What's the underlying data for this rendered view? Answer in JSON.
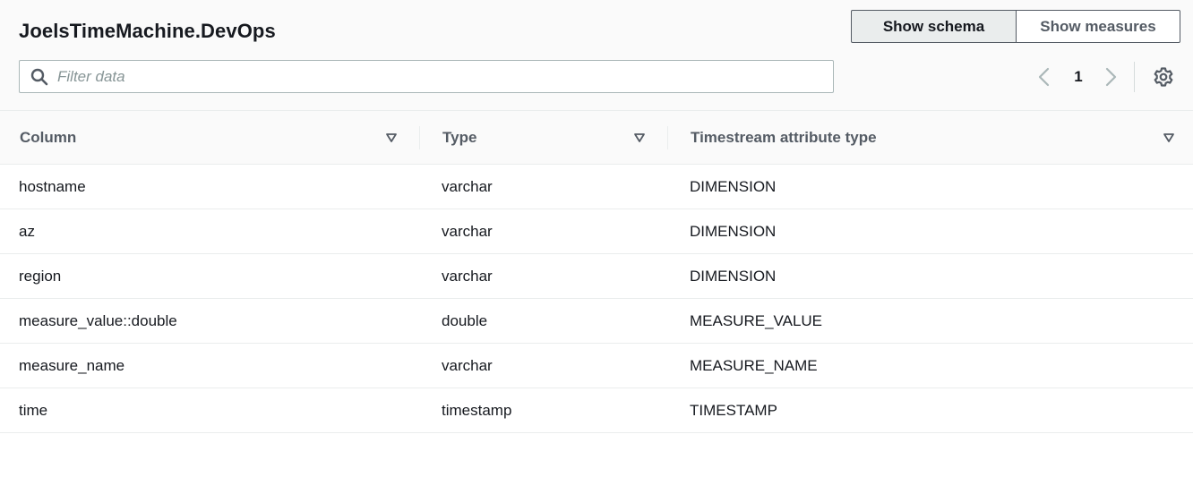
{
  "header": {
    "title": "JoelsTimeMachine.DevOps",
    "toggle": {
      "schema_label": "Show schema",
      "measures_label": "Show measures",
      "selected": "schema"
    }
  },
  "filter": {
    "placeholder": "Filter data",
    "value": ""
  },
  "pagination": {
    "current_page": "1"
  },
  "icons": {
    "search": "search-icon",
    "prev": "chevron-left-icon",
    "next": "chevron-right-icon",
    "settings": "gear-icon",
    "sort": "sort-caret-down-icon"
  },
  "table": {
    "columns": [
      "Column",
      "Type",
      "Timestream attribute type"
    ],
    "rows": [
      [
        "hostname",
        "varchar",
        "DIMENSION"
      ],
      [
        "az",
        "varchar",
        "DIMENSION"
      ],
      [
        "region",
        "varchar",
        "DIMENSION"
      ],
      [
        "measure_value::double",
        "double",
        "MEASURE_VALUE"
      ],
      [
        "measure_name",
        "varchar",
        "MEASURE_NAME"
      ],
      [
        "time",
        "timestamp",
        "TIMESTAMP"
      ]
    ]
  },
  "colors": {
    "text": "#16191f",
    "muted": "#545b64",
    "border": "#aab7b8",
    "header_bg": "#fafafa"
  }
}
